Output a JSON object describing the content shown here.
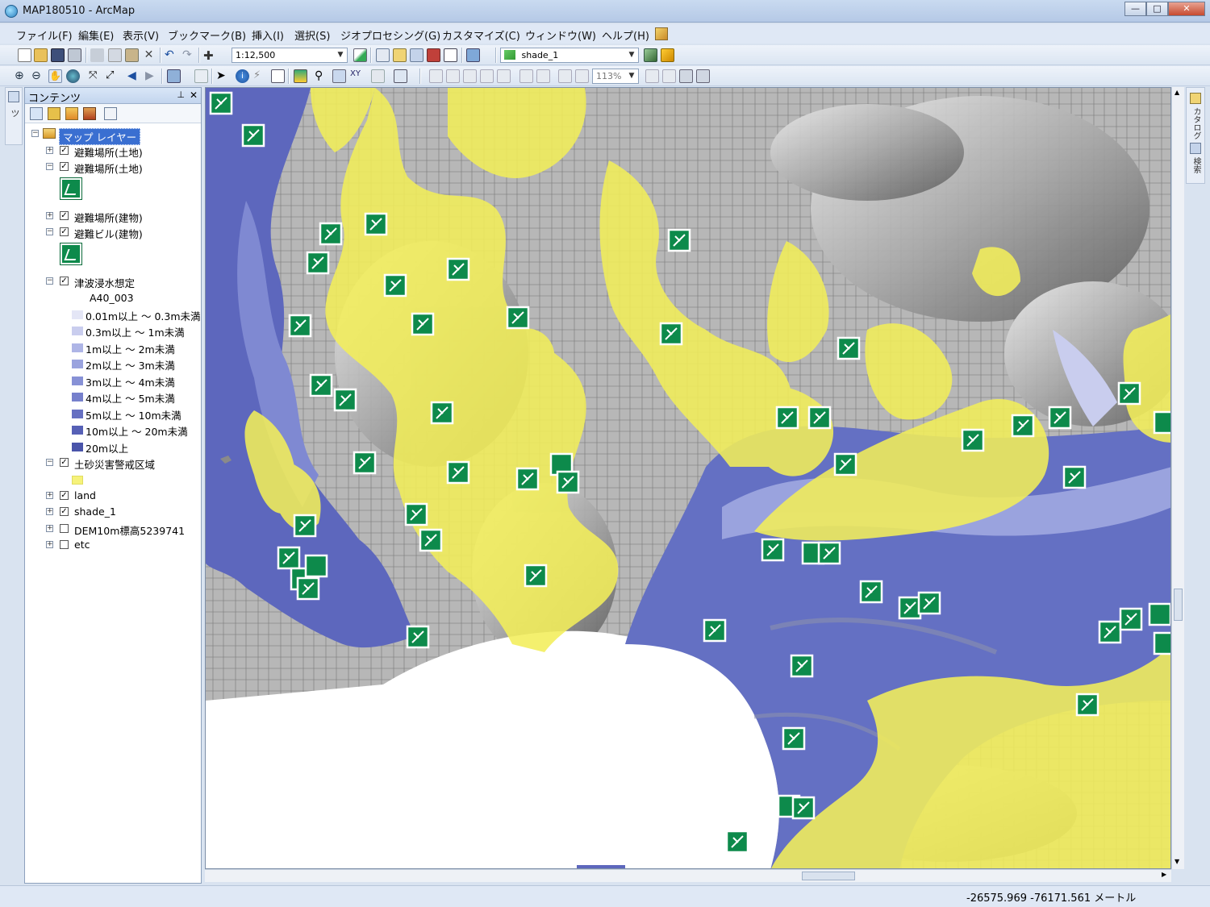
{
  "window": {
    "title": "MAP180510 - ArcMap",
    "minimize": "—",
    "maximize": "□",
    "close": "✕"
  },
  "menu": [
    "ファイル(F)",
    "編集(E)",
    "表示(V)",
    "ブックマーク(B)",
    "挿入(I)",
    "選択(S)",
    "ジオプロセシング(G)",
    "カスタマイズ(C)",
    "ウィンドウ(W)",
    "ヘルプ(H)"
  ],
  "toolbar": {
    "scale": "1:12,500",
    "layer_select": "shade_1",
    "zoom_percent": "113%"
  },
  "toc": {
    "title": "コンテンツ",
    "root": "マップ レイヤー",
    "layers": [
      {
        "label": "避難場所(土地)",
        "checked": true,
        "expanded": false
      },
      {
        "label": "避難場所(土地)",
        "checked": true,
        "expanded": true
      },
      {
        "label": "避難場所(建物)",
        "checked": true,
        "expanded": false
      },
      {
        "label": "避難ビル(建物)",
        "checked": true,
        "expanded": true
      },
      {
        "label": "津波浸水想定",
        "checked": true,
        "expanded": true
      },
      {
        "label": "土砂災害警戒区域",
        "checked": true,
        "expanded": true
      },
      {
        "label": "land",
        "checked": true,
        "expanded": false
      },
      {
        "label": "shade_1",
        "checked": true,
        "expanded": false
      },
      {
        "label": "DEM10m標高5239741",
        "checked": false,
        "expanded": false
      },
      {
        "label": "etc",
        "checked": false,
        "expanded": false
      }
    ],
    "tsunami_field": "A40_003",
    "tsunami_classes": [
      {
        "label": "0.01m以上 ～ 0.3m未満",
        "color": "#e4e6f6"
      },
      {
        "label": "0.3m以上 ～ 1m未満",
        "color": "#c9cdee"
      },
      {
        "label": "1m以上 ～ 2m未満",
        "color": "#aeb5e6"
      },
      {
        "label": "2m以上 ～ 3m未満",
        "color": "#9aa3de"
      },
      {
        "label": "3m以上 ～ 4m未満",
        "color": "#8791d6"
      },
      {
        "label": "4m以上 ～ 5m未満",
        "color": "#7680cc"
      },
      {
        "label": "5m以上 ～ 10m未満",
        "color": "#6670c2"
      },
      {
        "label": "10m以上 ～ 20m未満",
        "color": "#5660b6"
      },
      {
        "label": "20m以上",
        "color": "#4a54aa"
      }
    ],
    "landslide_color": "#f6f27a"
  },
  "right_panel": [
    "カタログ",
    "検索"
  ],
  "status": {
    "coordinates": "-26575.969  -76171.561 メートル"
  }
}
